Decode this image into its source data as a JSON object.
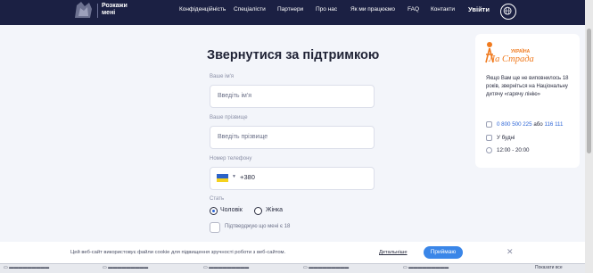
{
  "brand": {
    "logo_line1": "Розкажи",
    "logo_line2": "мені"
  },
  "nav": {
    "items": [
      "Конфіденційність",
      "Спеціалісти",
      "Партнери",
      "Про нас",
      "Як ми працюємо",
      "FAQ",
      "Контакти"
    ],
    "login": "Увійти"
  },
  "form": {
    "title": "Звернутися за підтримкою",
    "first_name_label": "Ваше ім'я",
    "first_name_placeholder": "Введіть ім'я",
    "last_name_label": "Ваше прізвище",
    "last_name_placeholder": "Введіть прізвище",
    "phone_label": "Номер телефону",
    "phone_prefix": "+380",
    "gender_label": "Стать",
    "gender_options": [
      "Чоловік",
      "Жінка"
    ],
    "gender_selected": "Чоловік",
    "age_confirm": "Підтверджую що мені є 18"
  },
  "card": {
    "brand_small": "УКРАЇНА",
    "brand": "Ла Страда",
    "text": "Якщо Вам ще не виповнилось 18 років, зверніться на Національну дитячу «гарячу лінію»",
    "phone_main": "0 800 500 225",
    "phone_or": "або",
    "phone_short": "116 111",
    "days": "У будні",
    "hours": "12:00 - 20:00",
    "accent_color": "#f07a1e"
  },
  "cookie": {
    "text": "Цей веб-сайт використовує файли cookie для підвищення зручності роботи з веб-сайтом.",
    "more": "Детальніше",
    "accept": "Приймаю"
  },
  "taskbar": {
    "right_button": "Показати все"
  },
  "colors": {
    "header": "#1b2043",
    "primary": "#3a86e8"
  }
}
